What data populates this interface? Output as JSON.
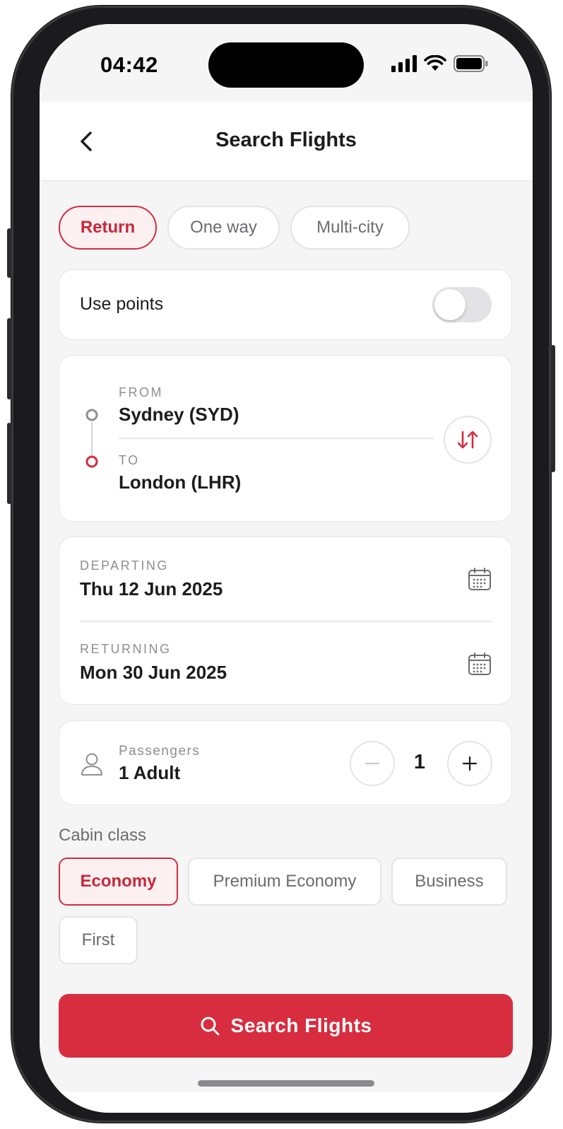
{
  "status_bar": {
    "time": "04:42"
  },
  "nav": {
    "title": "Search Flights"
  },
  "trip_types": [
    {
      "label": "Return",
      "active": true
    },
    {
      "label": "One way",
      "active": false
    },
    {
      "label": "Multi-city",
      "active": false
    }
  ],
  "points": {
    "label": "Use points",
    "enabled": false
  },
  "route": {
    "from_label": "FROM",
    "from_value": "Sydney (SYD)",
    "to_label": "TO",
    "to_value": "London (LHR)"
  },
  "dates": {
    "departing_label": "DEPARTING",
    "departing_value": "Thu 12 Jun 2025",
    "returning_label": "RETURNING",
    "returning_value": "Mon 30 Jun 2025"
  },
  "passengers": {
    "label": "Passengers",
    "value": "1 Adult",
    "count": "1"
  },
  "cabin": {
    "label": "Cabin class",
    "options": [
      {
        "label": "Economy",
        "active": true
      },
      {
        "label": "Premium Economy",
        "active": false
      },
      {
        "label": "Business",
        "active": false
      },
      {
        "label": "First",
        "active": false
      }
    ]
  },
  "search_button": {
    "label": "Search Flights"
  },
  "colors": {
    "accent": "#d72d3f",
    "accent_bg": "#fdf0f1",
    "background": "#f5f5f5"
  }
}
